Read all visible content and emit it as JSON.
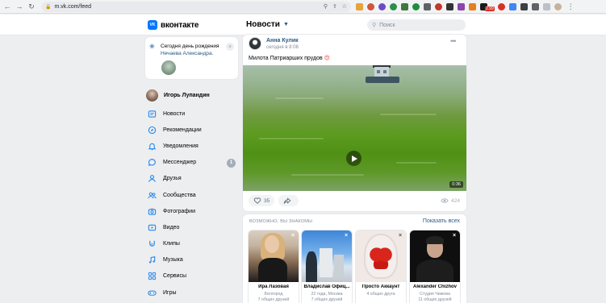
{
  "browser": {
    "url": "m.vk.com/feed",
    "extension_badge": "2.99"
  },
  "header": {
    "logo_text": "вконтакте",
    "logo_mark": "VK",
    "section_title": "Новости",
    "search_placeholder": "Поиск"
  },
  "birthday": {
    "title": "Сегодня день рождения",
    "name": "Нечаева Александра."
  },
  "profile": {
    "name": "Игорь Лупандин"
  },
  "sidebar": {
    "items": [
      {
        "label": "Новости",
        "icon": "newspaper-icon"
      },
      {
        "label": "Рекомендации",
        "icon": "compass-icon"
      },
      {
        "label": "Уведомления",
        "icon": "bell-icon"
      },
      {
        "label": "Мессенджер",
        "icon": "chat-icon",
        "badge": "1"
      },
      {
        "label": "Друзья",
        "icon": "user-icon"
      },
      {
        "label": "Сообщества",
        "icon": "users-icon"
      },
      {
        "label": "Фотографии",
        "icon": "camera-icon"
      },
      {
        "label": "Видео",
        "icon": "video-icon"
      },
      {
        "label": "Клипы",
        "icon": "clips-icon"
      },
      {
        "label": "Музыка",
        "icon": "music-icon"
      },
      {
        "label": "Сервисы",
        "icon": "grid-icon"
      },
      {
        "label": "Игры",
        "icon": "gamepad-icon"
      }
    ]
  },
  "post": {
    "author": "Анна Кулик",
    "time": "сегодня в 8:08",
    "text": "Милота Патриарших прудов",
    "emoji": "😍",
    "video_duration": "0:36",
    "likes": "35",
    "views": "424"
  },
  "friends": {
    "title": "ВОЗМОЖНО, ВЫ ЗНАКОМЫ",
    "show_all": "Показать всех",
    "cards": [
      {
        "name": "Ира Лазовая",
        "line1": "Белгород",
        "line2": "7 общих друзей"
      },
      {
        "name": "Владислав Офиц...",
        "line1": "22 года, Москва",
        "line2": "7 общих друзей"
      },
      {
        "name": "Просто Аккаунт",
        "line1": "4 общих друга",
        "line2": ""
      },
      {
        "name": "Alexander Chizhov",
        "line1": "Студия Чижова",
        "line2": "11 общих друзей"
      }
    ]
  },
  "colors": {
    "accent": "#0077ff",
    "link": "#2a5885",
    "icon_blue": "#2688eb",
    "page_bg": "#edeef0"
  }
}
